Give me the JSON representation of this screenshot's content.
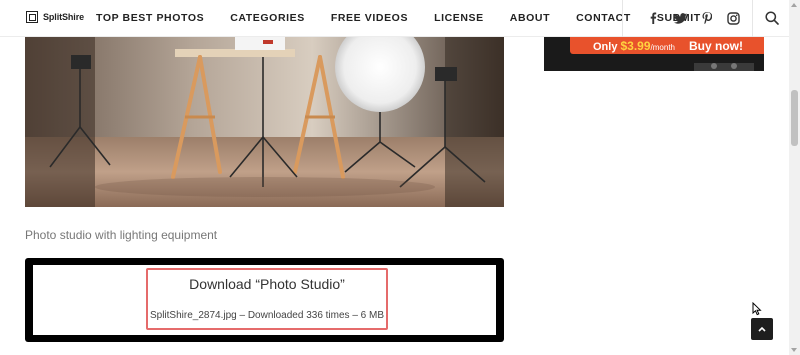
{
  "header": {
    "logo_text": "SplitShire",
    "nav": [
      {
        "label": "TOP BEST PHOTOS"
      },
      {
        "label": "CATEGORIES"
      },
      {
        "label": "FREE VIDEOS"
      },
      {
        "label": "LICENSE"
      },
      {
        "label": "ABOUT"
      },
      {
        "label": "CONTACT"
      },
      {
        "label": "SUBMIT"
      }
    ],
    "social_icons": [
      "facebook-icon",
      "twitter-icon",
      "pinterest-icon",
      "instagram-icon"
    ],
    "search_icon": "search-icon"
  },
  "ad": {
    "price_prefix": "Only ",
    "price": "$3.99",
    "per": "/month",
    "cta": "Buy now!"
  },
  "photo": {
    "caption": "Photo studio with lighting equipment"
  },
  "download": {
    "title": "Download “Photo Studio”",
    "meta": "SplitShire_2874.jpg – Downloaded 336 times – 6 MB"
  },
  "colors": {
    "accent": "#e8522c",
    "highlight": "#e56b6b",
    "text": "#333333"
  }
}
